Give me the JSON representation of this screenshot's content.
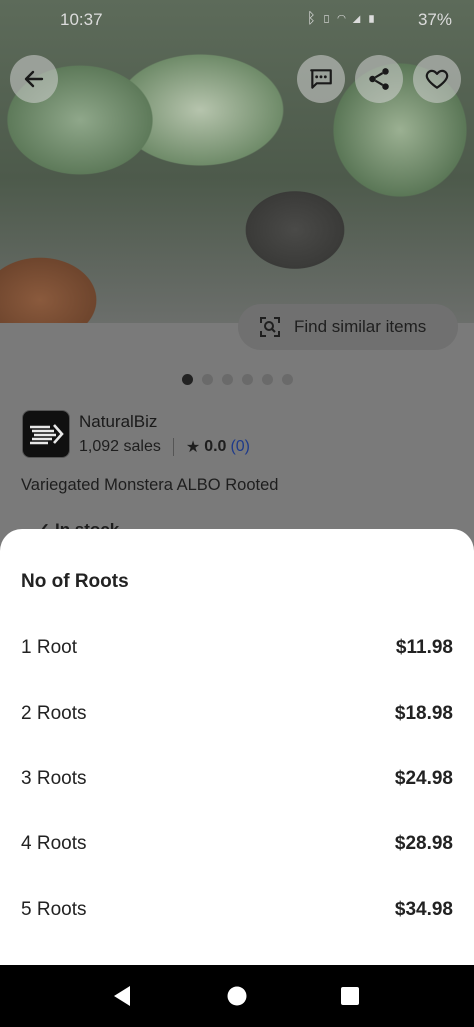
{
  "status_bar": {
    "time": "10:37",
    "battery": "37%",
    "icons": [
      "bluetooth-icon",
      "vibrate-icon",
      "wifi-icon",
      "signal-icon",
      "battery-icon"
    ]
  },
  "header_actions": {
    "back": "back-arrow-icon",
    "message": "message-icon",
    "share": "share-icon",
    "favorite": "heart-icon"
  },
  "find_similar": {
    "label": "Find similar items"
  },
  "carousel": {
    "total": 6,
    "active_index": 0
  },
  "shop": {
    "name": "NaturalBiz",
    "sales": "1,092 sales",
    "rating": "0.0",
    "review_count": "(0)"
  },
  "listing": {
    "title": "Variegated Monstera ALBO Rooted",
    "stock": "In stock"
  },
  "sheet": {
    "title": "No of Roots",
    "options": [
      {
        "label": "1 Root",
        "price": "$11.98"
      },
      {
        "label": "2 Roots",
        "price": "$18.98"
      },
      {
        "label": "3 Roots",
        "price": "$24.98"
      },
      {
        "label": "4 Roots",
        "price": "$28.98"
      },
      {
        "label": "5 Roots",
        "price": "$34.98"
      }
    ]
  },
  "nav_bar": {
    "back": "nav-back-icon",
    "home": "nav-home-icon",
    "recents": "nav-recents-icon"
  }
}
